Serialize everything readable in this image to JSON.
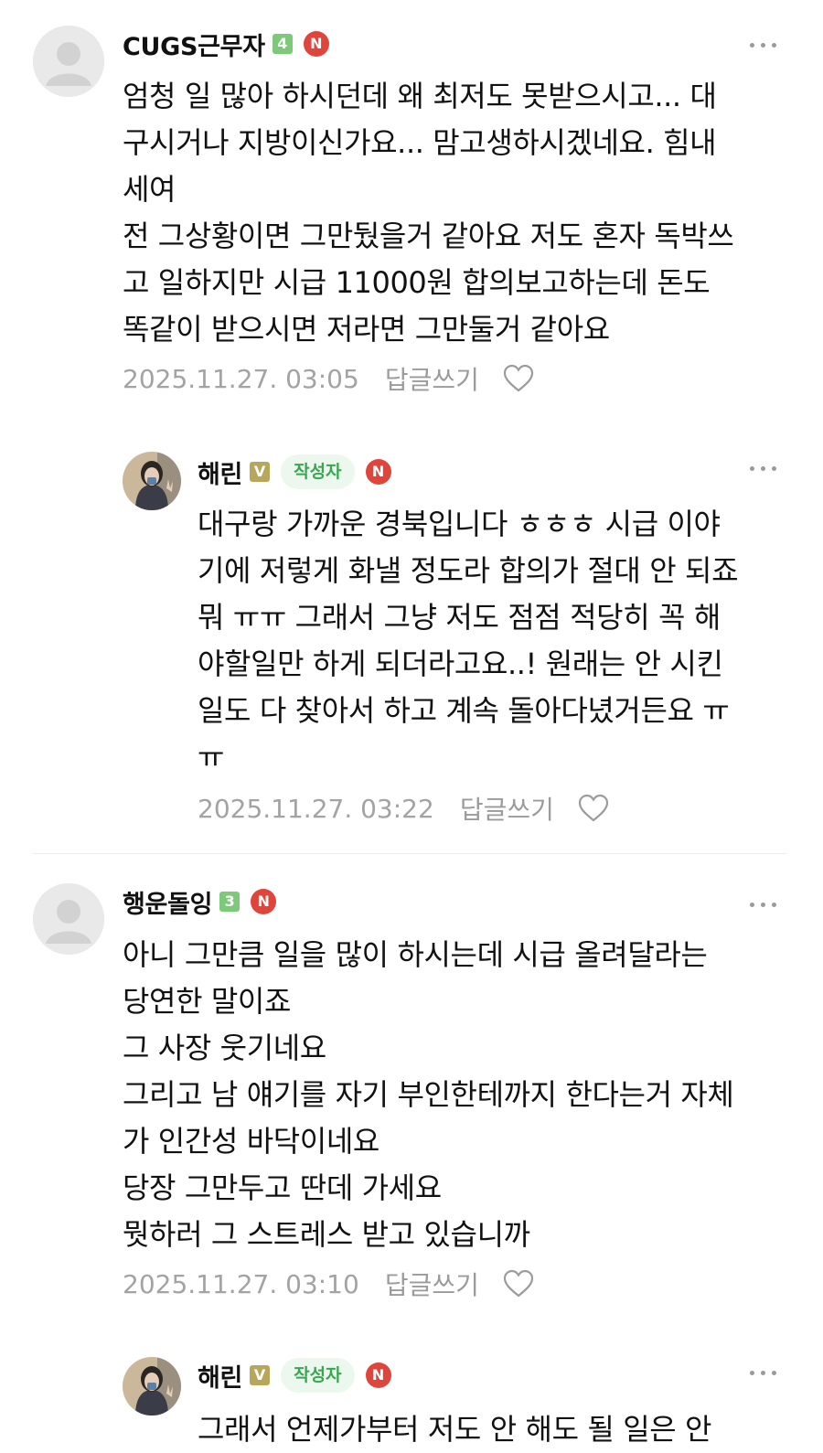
{
  "comments": [
    {
      "nickname": "CUGS근무자",
      "level": "4",
      "new_badge": "N",
      "lines": [
        "엄청 일 많아 하시던데 왜 최저도 못받으시고... 대",
        "구시거나 지방이신가요... 맘고생하시겠네요. 힘내",
        "세여",
        "전 그상황이면 그만뒀을거 같아요 저도 혼자 독박쓰",
        "고 일하지만 시급 11000원 합의보고하는데 돈도",
        "똑같이 받으시면 저라면 그만둘거 같아요"
      ],
      "timestamp": "2025.11.27. 03:05",
      "reply_label": "답글쓰기"
    },
    {
      "nickname": "해린",
      "level": "V",
      "author_badge": "작성자",
      "new_badge": "N",
      "lines": [
        "대구랑 가까운 경북입니다 ㅎㅎㅎ 시급 이야",
        "기에 저렇게 화낼 정도라 합의가 절대 안 되죠",
        "뭐 ㅠㅠ 그래서 그냥 저도 점점 적당히 꼭 해",
        "야할일만 하게 되더라고요..! 원래는 안 시킨",
        "일도 다 찾아서 하고 계속 돌아다녔거든요 ㅠ",
        "ㅠ"
      ],
      "timestamp": "2025.11.27. 03:22",
      "reply_label": "답글쓰기"
    },
    {
      "nickname": "행운돌잉",
      "level": "3",
      "new_badge": "N",
      "lines": [
        "아니 그만큼 일을 많이 하시는데 시급 올려달라는",
        "당연한 말이죠",
        "그 사장 웃기네요",
        "그리고 남 얘기를 자기 부인한테까지 한다는거 자체",
        "가 인간성 바닥이네요",
        "당장 그만두고 딴데 가세요",
        "뭣하러 그 스트레스 받고 있습니까"
      ],
      "timestamp": "2025.11.27. 03:10",
      "reply_label": "답글쓰기"
    },
    {
      "nickname": "해린",
      "level": "V",
      "author_badge": "작성자",
      "new_badge": "N",
      "lines": [
        "그래서 언제가부터 저도 안 해도 될 일은 안"
      ]
    }
  ],
  "colors": {
    "new_badge": "#e0453b",
    "author_badge_bg": "#ecf8ee",
    "author_badge_text": "#39a750",
    "level_green": "#7cc97a",
    "level_v": "#b8a75a",
    "meta_text": "#a3a3a3"
  },
  "icons": [
    "default-avatar-icon",
    "profile-photo-icon",
    "more-options-icon",
    "heart-icon"
  ]
}
